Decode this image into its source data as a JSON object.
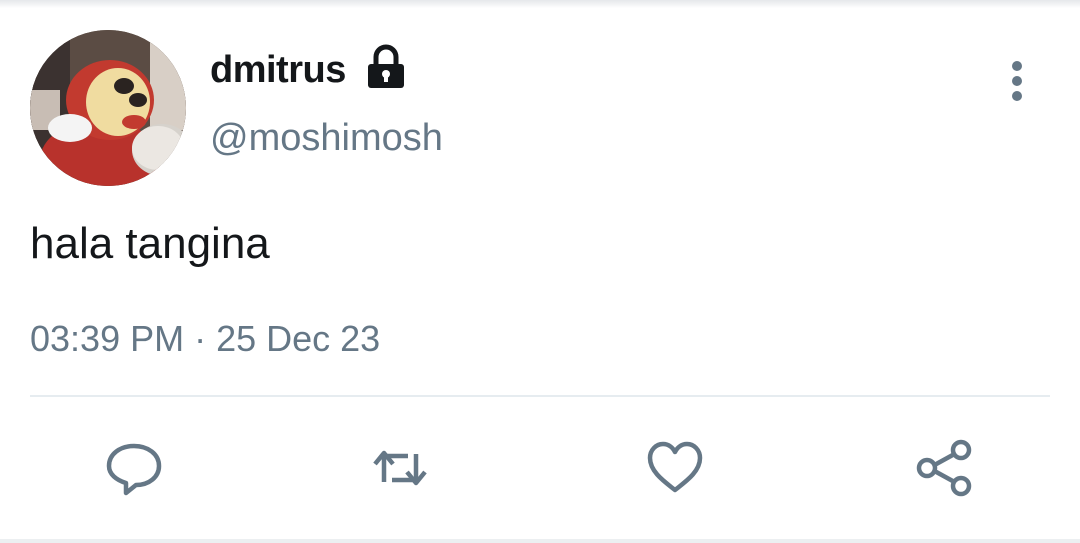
{
  "tweet": {
    "display_name": "dmitrus",
    "handle": "@moshimosh",
    "text": "hala tangina",
    "timestamp": "03:39 PM · 25 Dec 23",
    "protected": true
  },
  "icons": {
    "lock": "lock-icon",
    "more": "more-vertical-icon",
    "reply": "reply-icon",
    "retweet": "retweet-icon",
    "like": "heart-icon",
    "share": "share-icon"
  },
  "colors": {
    "text_primary": "#14171a",
    "text_secondary": "#657786",
    "divider": "#e6ecf0"
  }
}
